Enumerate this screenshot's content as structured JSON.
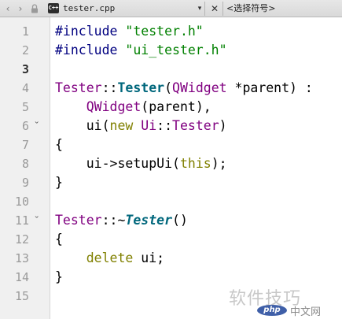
{
  "toolbar": {
    "back_icon": "‹",
    "forward_icon": "›",
    "lock_icon": "🔒",
    "file_type_label": "C++",
    "file_name": "tester.cpp",
    "file_dropdown_icon": "▾",
    "close_icon": "✕",
    "symbol_placeholder": "<选择符号>"
  },
  "editor": {
    "current_line": 3,
    "lines": [
      {
        "num": "1",
        "fold": "",
        "tokens": [
          {
            "t": "#include ",
            "k": "pre"
          },
          {
            "t": "\"tester.h\"",
            "k": "str"
          }
        ]
      },
      {
        "num": "2",
        "fold": "",
        "tokens": [
          {
            "t": "#include ",
            "k": "pre"
          },
          {
            "t": "\"ui_tester.h\"",
            "k": "str"
          }
        ]
      },
      {
        "num": "3",
        "fold": "",
        "tokens": []
      },
      {
        "num": "4",
        "fold": "",
        "tokens": [
          {
            "t": "Tester",
            "k": "cls"
          },
          {
            "t": "::",
            "k": "txt"
          },
          {
            "t": "Tester",
            "k": "fn"
          },
          {
            "t": "(",
            "k": "txt"
          },
          {
            "t": "QWidget",
            "k": "cls"
          },
          {
            "t": " *parent) :",
            "k": "txt"
          }
        ]
      },
      {
        "num": "5",
        "fold": "",
        "tokens": [
          {
            "t": "    ",
            "k": "txt"
          },
          {
            "t": "QWidget",
            "k": "cls"
          },
          {
            "t": "(parent),",
            "k": "txt"
          }
        ]
      },
      {
        "num": "6",
        "fold": "ˇ",
        "tokens": [
          {
            "t": "    ui(",
            "k": "txt"
          },
          {
            "t": "new",
            "k": "kw"
          },
          {
            "t": " ",
            "k": "txt"
          },
          {
            "t": "Ui",
            "k": "cls"
          },
          {
            "t": "::",
            "k": "txt"
          },
          {
            "t": "Tester",
            "k": "cls"
          },
          {
            "t": ")",
            "k": "txt"
          }
        ]
      },
      {
        "num": "7",
        "fold": "",
        "tokens": [
          {
            "t": "{",
            "k": "txt"
          }
        ]
      },
      {
        "num": "8",
        "fold": "",
        "tokens": [
          {
            "t": "    ui->setupUi(",
            "k": "txt"
          },
          {
            "t": "this",
            "k": "kw"
          },
          {
            "t": ");",
            "k": "txt"
          }
        ]
      },
      {
        "num": "9",
        "fold": "",
        "tokens": [
          {
            "t": "}",
            "k": "txt"
          }
        ]
      },
      {
        "num": "10",
        "fold": "",
        "tokens": []
      },
      {
        "num": "11",
        "fold": "ˇ",
        "tokens": [
          {
            "t": "Tester",
            "k": "cls"
          },
          {
            "t": "::~",
            "k": "txt"
          },
          {
            "t": "Tester",
            "k": "fni"
          },
          {
            "t": "()",
            "k": "txt"
          }
        ]
      },
      {
        "num": "12",
        "fold": "",
        "tokens": [
          {
            "t": "{",
            "k": "txt"
          }
        ]
      },
      {
        "num": "13",
        "fold": "",
        "tokens": [
          {
            "t": "    ",
            "k": "txt"
          },
          {
            "t": "delete",
            "k": "kw"
          },
          {
            "t": " ui;",
            "k": "txt"
          }
        ]
      },
      {
        "num": "14",
        "fold": "",
        "tokens": [
          {
            "t": "}",
            "k": "txt"
          }
        ]
      },
      {
        "num": "15",
        "fold": "",
        "tokens": []
      }
    ]
  },
  "watermark": {
    "text": "软件技巧",
    "logo_text": "php",
    "site_text": "中文网"
  },
  "colors": {
    "preprocessor": "#000080",
    "string": "#008000",
    "class": "#800080",
    "function": "#00677c",
    "keyword": "#808000",
    "gutter_bg": "#f0f0f0"
  }
}
